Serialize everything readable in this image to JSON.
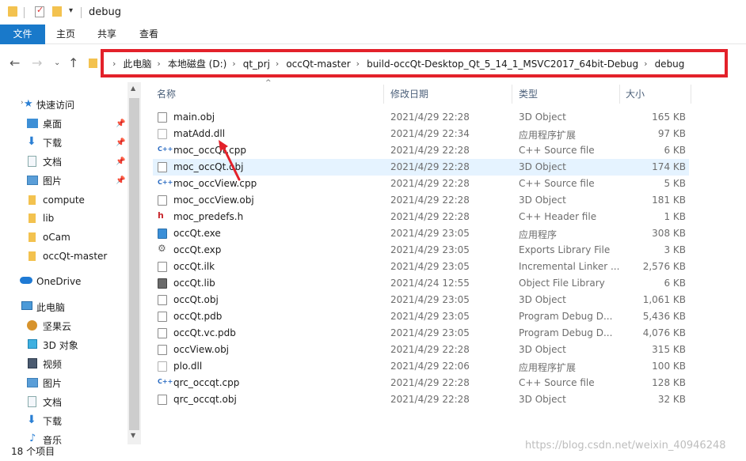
{
  "window": {
    "title": "debug"
  },
  "ribbon": {
    "tabs": [
      "文件",
      "主页",
      "共享",
      "查看"
    ]
  },
  "address": {
    "crumbs": [
      "此电脑",
      "本地磁盘 (D:)",
      "qt_prj",
      "occQt-master",
      "build-occQt-Desktop_Qt_5_14_1_MSVC2017_64bit-Debug",
      "debug"
    ]
  },
  "navpane": {
    "items": [
      {
        "label": "快速访问",
        "icon": "star-icon"
      },
      {
        "label": "桌面",
        "icon": "desktop-icon"
      },
      {
        "label": "下载",
        "icon": "download-icon"
      },
      {
        "label": "文档",
        "icon": "document-icon"
      },
      {
        "label": "图片",
        "icon": "picture-icon"
      },
      {
        "label": "compute",
        "icon": "folder-icon"
      },
      {
        "label": "lib",
        "icon": "folder-icon"
      },
      {
        "label": "oCam",
        "icon": "folder-icon"
      },
      {
        "label": "occQt-master",
        "icon": "folder-icon"
      },
      {
        "label": "OneDrive",
        "icon": "cloud-icon"
      },
      {
        "label": "此电脑",
        "icon": "computer-icon"
      },
      {
        "label": "坚果云",
        "icon": "nut-icon"
      },
      {
        "label": "3D 对象",
        "icon": "cube-icon"
      },
      {
        "label": "视频",
        "icon": "video-icon"
      },
      {
        "label": "图片",
        "icon": "picture-icon"
      },
      {
        "label": "文档",
        "icon": "document-icon"
      },
      {
        "label": "下载",
        "icon": "download-icon"
      },
      {
        "label": "音乐",
        "icon": "music-icon"
      }
    ]
  },
  "columns": {
    "name": "名称",
    "date": "修改日期",
    "type": "类型",
    "size": "大小"
  },
  "files": [
    {
      "name": "main.obj",
      "date": "2021/4/29 22:28",
      "type": "3D Object",
      "size": "165 KB"
    },
    {
      "name": "matAdd.dll",
      "date": "2021/4/29 22:34",
      "type": "应用程序扩展",
      "size": "97 KB"
    },
    {
      "name": "moc_occQt.cpp",
      "date": "2021/4/29 22:28",
      "type": "C++ Source file",
      "size": "6 KB"
    },
    {
      "name": "moc_occQt.obj",
      "date": "2021/4/29 22:28",
      "type": "3D Object",
      "size": "174 KB"
    },
    {
      "name": "moc_occView.cpp",
      "date": "2021/4/29 22:28",
      "type": "C++ Source file",
      "size": "5 KB"
    },
    {
      "name": "moc_occView.obj",
      "date": "2021/4/29 22:28",
      "type": "3D Object",
      "size": "181 KB"
    },
    {
      "name": "moc_predefs.h",
      "date": "2021/4/29 22:28",
      "type": "C++ Header file",
      "size": "1 KB"
    },
    {
      "name": "occQt.exe",
      "date": "2021/4/29 23:05",
      "type": "应用程序",
      "size": "308 KB"
    },
    {
      "name": "occQt.exp",
      "date": "2021/4/29 23:05",
      "type": "Exports Library File",
      "size": "3 KB"
    },
    {
      "name": "occQt.ilk",
      "date": "2021/4/29 23:05",
      "type": "Incremental Linker ...",
      "size": "2,576 KB"
    },
    {
      "name": "occQt.lib",
      "date": "2021/4/24 12:55",
      "type": "Object File Library",
      "size": "6 KB"
    },
    {
      "name": "occQt.obj",
      "date": "2021/4/29 23:05",
      "type": "3D Object",
      "size": "1,061 KB"
    },
    {
      "name": "occQt.pdb",
      "date": "2021/4/29 23:05",
      "type": "Program Debug D...",
      "size": "5,436 KB"
    },
    {
      "name": "occQt.vc.pdb",
      "date": "2021/4/29 23:05",
      "type": "Program Debug D...",
      "size": "4,076 KB"
    },
    {
      "name": "occView.obj",
      "date": "2021/4/29 22:28",
      "type": "3D Object",
      "size": "315 KB"
    },
    {
      "name": "plo.dll",
      "date": "2021/4/29 22:06",
      "type": "应用程序扩展",
      "size": "100 KB"
    },
    {
      "name": "qrc_occqt.cpp",
      "date": "2021/4/29 22:28",
      "type": "C++ Source file",
      "size": "128 KB"
    },
    {
      "name": "qrc_occqt.obj",
      "date": "2021/4/29 22:28",
      "type": "3D Object",
      "size": "32 KB"
    }
  ],
  "selected_row": 3,
  "status": {
    "count": "18 个项目"
  },
  "watermark": "https://blog.csdn.net/weixin_40946248",
  "colors": {
    "accent": "#1979ca",
    "highlight_box": "#e3212a",
    "selection": "#e5f3ff"
  }
}
